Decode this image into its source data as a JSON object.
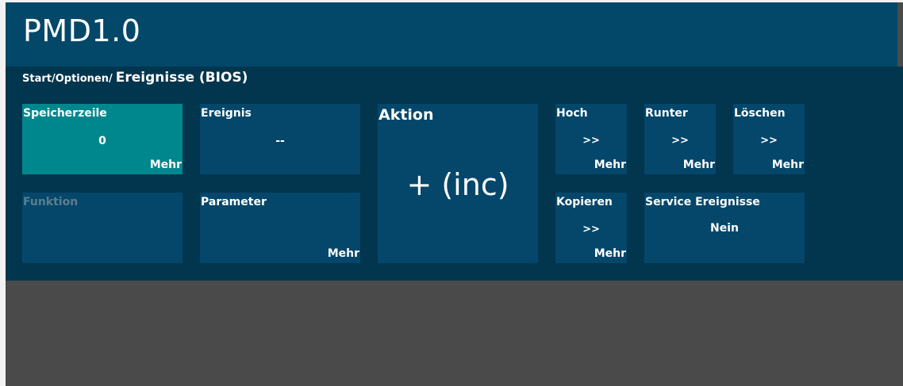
{
  "app": {
    "title": "PMD1.0"
  },
  "breadcrumb": {
    "path": "Start/Optionen/",
    "current": "Ereignisse (BIOS)"
  },
  "tiles": {
    "speicherzeile": {
      "label": "Speicherzeile",
      "value": "0",
      "more": "Mehr"
    },
    "ereignis": {
      "label": "Ereignis",
      "value": "--"
    },
    "funktion": {
      "label": "Funktion"
    },
    "parameter": {
      "label": "Parameter",
      "more": "Mehr"
    },
    "aktion": {
      "label": "Aktion",
      "value": "+ (inc)"
    },
    "hoch": {
      "label": "Hoch",
      "value": ">>",
      "more": "Mehr"
    },
    "runter": {
      "label": "Runter",
      "value": ">>",
      "more": "Mehr"
    },
    "loeschen": {
      "label": "Löschen",
      "value": ">>",
      "more": "Mehr"
    },
    "kopieren": {
      "label": "Kopieren",
      "value": ">>",
      "more": "Mehr"
    },
    "service": {
      "label": "Service Ereignisse",
      "value": "Nein"
    }
  },
  "colors": {
    "header": "#044869",
    "panel": "#02354e",
    "tile": "#04476a",
    "tile_active": "#00878d",
    "background": "#4a4a4a"
  }
}
